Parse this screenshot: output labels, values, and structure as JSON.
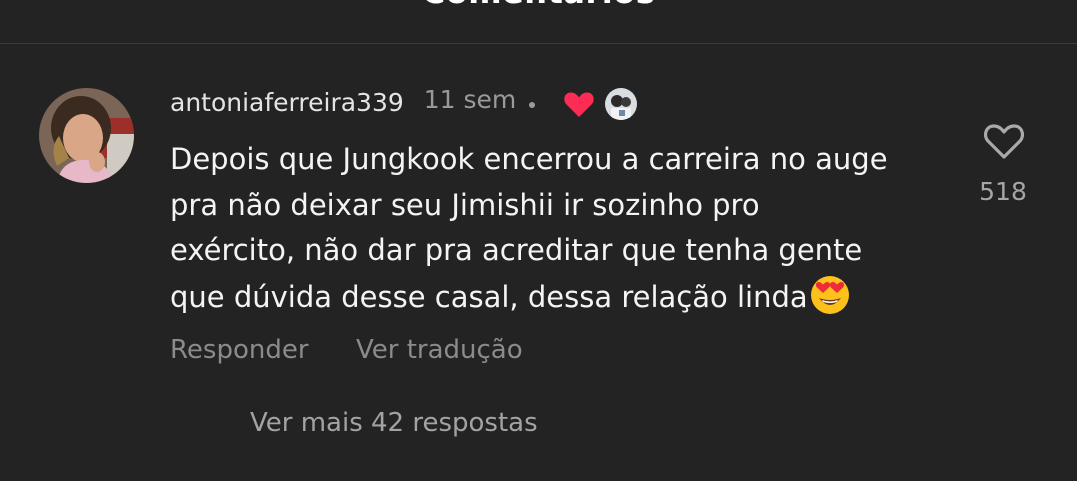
{
  "header": {
    "title": "Comentários"
  },
  "comment": {
    "username": "antoniaferreira339",
    "timestamp": "11 sem",
    "text_lines": [
      "Depois que Jungkook encerrou a carreira no auge",
      "pra não deixar seu Jimishii ir sozinho pro",
      "exército, não dar pra acreditar que tenha gente",
      "que dúvida desse casal, dessa relação linda"
    ],
    "emoji": "heart-eyes-emoji",
    "like_count": "518",
    "reply_label": "Responder",
    "translate_label": "Ver tradução",
    "more_replies_label": "Ver mais 42 respostas",
    "creator_liked": true
  },
  "icons": {
    "creator_heart": "heart-icon",
    "like": "heart-outline-icon"
  },
  "colors": {
    "background": "#232323",
    "heart": "#fe2c55",
    "secondary_text": "#8b8b8b"
  }
}
